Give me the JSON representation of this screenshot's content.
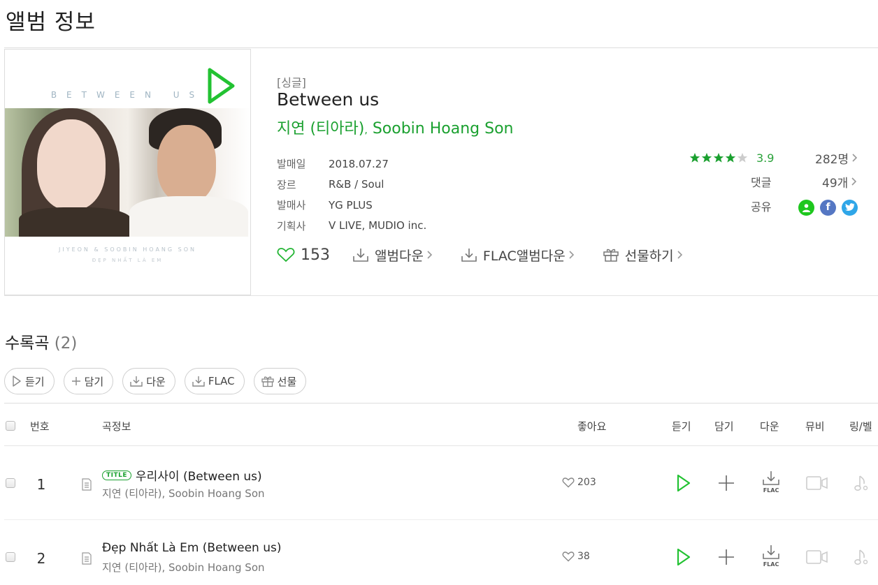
{
  "page": {
    "title": "앨범 정보"
  },
  "album": {
    "cover_text": {
      "title": "BETWEEN US",
      "artists": "JIYEON & SOOBIN HOANG SON",
      "subtitle": "ĐẸP NHẤT LÀ EM"
    },
    "type": "[싱글]",
    "title": "Between us",
    "artists": [
      "지연 (티아라)",
      "Soobin Hoang Son"
    ],
    "artist_separator": ",",
    "meta": [
      {
        "key": "발매일",
        "value": "2018.07.27"
      },
      {
        "key": "장르",
        "value": "R&B / Soul"
      },
      {
        "key": "발매사",
        "value": "YG PLUS"
      },
      {
        "key": "기획사",
        "value": "V LIVE, MUDIO inc."
      }
    ],
    "rating": {
      "stars": 4,
      "max": 5,
      "score": "3.9",
      "count": "282명"
    },
    "comments": {
      "label": "댓글",
      "count": "49개"
    },
    "share": {
      "label": "공유",
      "icons": [
        "profile-icon",
        "facebook-icon",
        "twitter-icon"
      ]
    },
    "likes": "153",
    "actions": {
      "download": "앨범다운",
      "flac": "FLAC앨범다운",
      "gift": "선물하기"
    }
  },
  "tracks_section": {
    "heading": "수록곡",
    "count": "(2)",
    "buttons": {
      "listen": "듣기",
      "add": "담기",
      "download": "다운",
      "flac": "FLAC",
      "gift": "선물"
    },
    "columns": {
      "number": "번호",
      "info": "곡정보",
      "likes": "좋아요",
      "listen": "듣기",
      "add": "담기",
      "download": "다운",
      "mv": "뮤비",
      "ring": "링/벨"
    },
    "title_badge": "TITLE",
    "tracks": [
      {
        "no": "1",
        "title": "우리사이 (Between us)",
        "is_title": true,
        "artists": "지연 (티아라), Soobin Hoang Son",
        "likes": "203"
      },
      {
        "no": "2",
        "title": "Đẹp Nhất Là Em (Between us)",
        "is_title": false,
        "artists": "지연 (티아라), Soobin Hoang Son",
        "likes": "38"
      }
    ],
    "flac_label": "FLAC"
  },
  "colors": {
    "accent": "#1aa02f",
    "star_on": "#1aa02f",
    "star_off": "#cccccc"
  }
}
